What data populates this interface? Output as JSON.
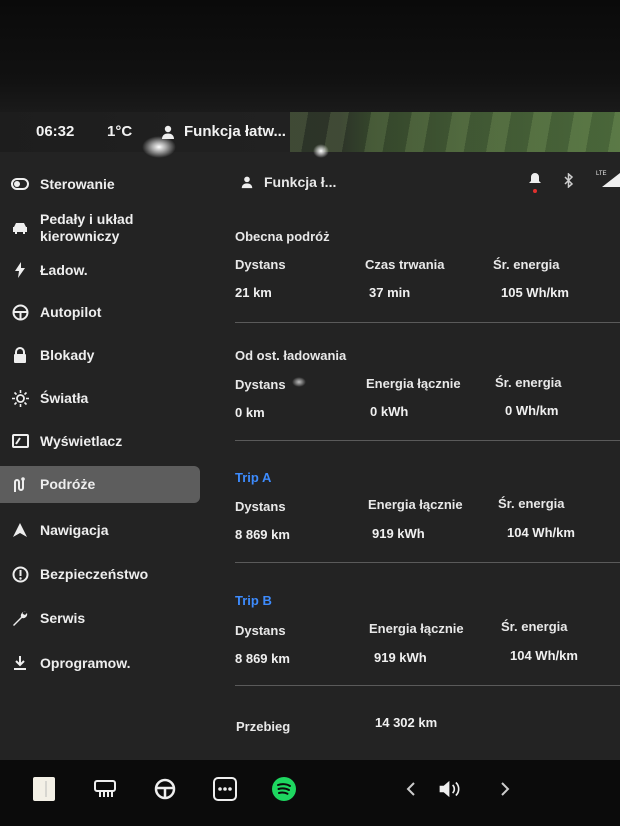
{
  "status": {
    "time": "06:32",
    "temperature": "1°C",
    "profile": "Funkcja łatw..."
  },
  "sidebar": {
    "items": [
      {
        "label": "Sterowanie",
        "icon": "toggle-icon"
      },
      {
        "label": "Pedały i układ kierowniczy",
        "icon": "car-icon"
      },
      {
        "label": "Ładow.",
        "icon": "lightning-icon"
      },
      {
        "label": "Autopilot",
        "icon": "steering-wheel-icon"
      },
      {
        "label": "Blokady",
        "icon": "lock-icon"
      },
      {
        "label": "Światła",
        "icon": "sun-icon"
      },
      {
        "label": "Wyświetlacz",
        "icon": "display-icon"
      },
      {
        "label": "Podróże",
        "icon": "trips-icon",
        "active": true
      },
      {
        "label": "Nawigacja",
        "icon": "navigation-icon"
      },
      {
        "label": "Bezpieczeństwo",
        "icon": "alert-circle-icon"
      },
      {
        "label": "Serwis",
        "icon": "wrench-icon"
      },
      {
        "label": "Oprogramow.",
        "icon": "download-icon"
      }
    ]
  },
  "header": {
    "profile": "Funkcja ł...",
    "lte": "LTE"
  },
  "current_trip": {
    "title": "Obecna podróż",
    "labels": [
      "Dystans",
      "Czas trwania",
      "Śr. energia"
    ],
    "values": [
      "21 km",
      "37 min",
      "105 Wh/km"
    ]
  },
  "since_charge": {
    "title": "Od ost. ładowania",
    "labels": [
      "Dystans",
      "Energia łącznie",
      "Śr. energia"
    ],
    "values": [
      "0 km",
      "0 kWh",
      "0 Wh/km"
    ]
  },
  "trip_a": {
    "title": "Trip A",
    "labels": [
      "Dystans",
      "Energia łącznie",
      "Śr. energia"
    ],
    "values": [
      "8 869 km",
      "919 kWh",
      "104 Wh/km"
    ]
  },
  "trip_b": {
    "title": "Trip B",
    "labels": [
      "Dystans",
      "Energia łącznie",
      "Śr. energia"
    ],
    "values": [
      "8 869 km",
      "919 kWh",
      "104 Wh/km"
    ]
  },
  "odometer": {
    "label": "Przebieg",
    "value": "14 302 km"
  },
  "colors": {
    "accent": "#3d8bfd",
    "spotify": "#1ed760",
    "alert": "#e0302e"
  }
}
